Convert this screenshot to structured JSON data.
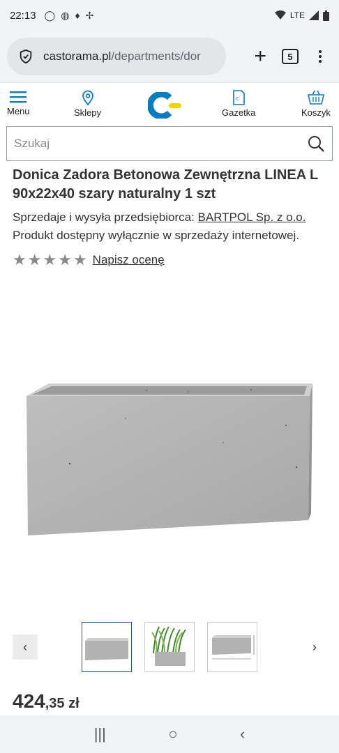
{
  "status_bar": {
    "time": "22:13",
    "network": "LTE"
  },
  "browser": {
    "url_domain": "castorama.pl",
    "url_path": "/departments/dor",
    "tab_count": "5"
  },
  "header": {
    "menu_label": "Menu",
    "stores_label": "Sklepy",
    "flyer_label": "Gazetka",
    "cart_label": "Koszyk",
    "brand_color": "#0a7cc1",
    "accent_color": "#f4d400"
  },
  "search": {
    "placeholder": "Szukaj"
  },
  "product": {
    "title": "Donica Zadora Betonowa Zewnętrzna LINEA L 90x22x40 szary naturalny 1 szt",
    "seller_prefix": "Sprzedaje i wysyła przedsiębiorca: ",
    "seller_name": "BARTPOL Sp. z o.o.",
    "availability": "Produkt dostępny wyłącznie w sprzedaży internetowej.",
    "rating_link": "Napisz ocenę",
    "price_main": "424",
    "price_decimal": ",35",
    "price_currency": " zł"
  },
  "gallery": {
    "prev": "‹",
    "next": "›"
  },
  "icons": {
    "shield": "shield-icon",
    "search": "search-icon",
    "cart": "cart-icon",
    "pin": "location-pin-icon"
  }
}
